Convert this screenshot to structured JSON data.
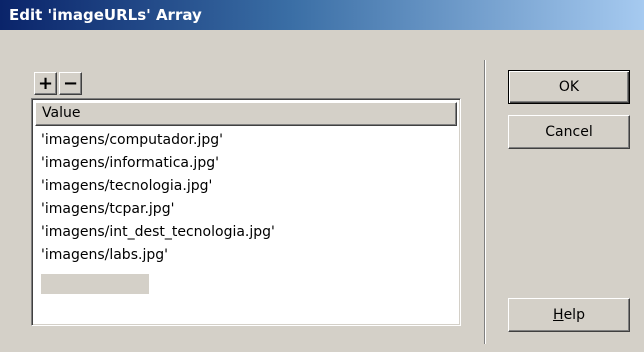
{
  "window": {
    "title": "Edit 'imageURLs' Array"
  },
  "toolbar": {
    "add_label": "+",
    "remove_label": "−"
  },
  "list": {
    "column_header": "Value",
    "rows": [
      "'imagens/computador.jpg'",
      "'imagens/informatica.jpg'",
      "'imagens/tecnologia.jpg'",
      "'imagens/tcpar.jpg'",
      "'imagens/int_dest_tecnologia.jpg'",
      "'imagens/labs.jpg'"
    ],
    "edit_value": ""
  },
  "buttons": {
    "ok": "OK",
    "cancel": "Cancel",
    "help_mnemonic": "H",
    "help_rest": "elp"
  },
  "colors": {
    "face": "#d4d0c8",
    "titlebar_start": "#0a246a",
    "titlebar_end": "#a6caf0",
    "list_background": "#ffffff"
  }
}
